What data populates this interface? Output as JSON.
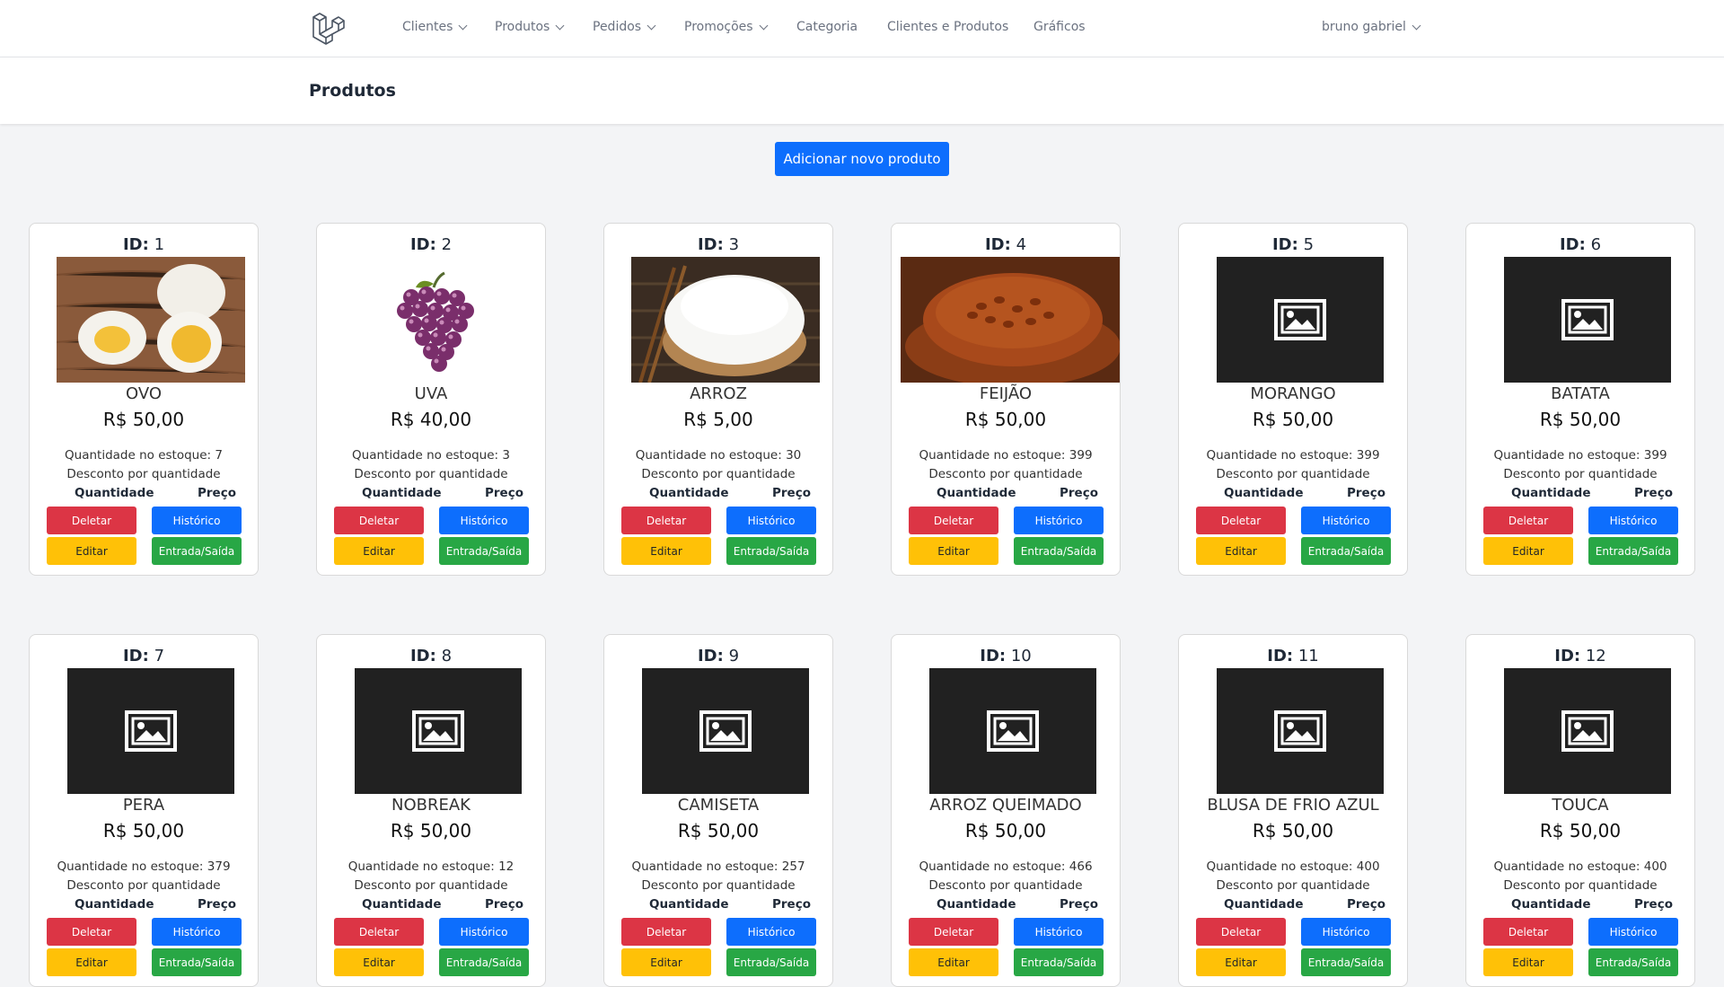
{
  "nav": {
    "items": [
      {
        "label": "Clientes",
        "dropdown": true
      },
      {
        "label": "Produtos",
        "dropdown": true
      },
      {
        "label": "Pedidos",
        "dropdown": true
      },
      {
        "label": "Promoções",
        "dropdown": true
      },
      {
        "label": "Categoria",
        "dropdown": false
      },
      {
        "label": "Clientes e Produtos",
        "dropdown": false
      },
      {
        "label": "Gráficos",
        "dropdown": false
      }
    ],
    "user": "bruno gabriel"
  },
  "page": {
    "title": "Produtos",
    "add_button": "Adicionar novo produto"
  },
  "labels": {
    "id": "ID:",
    "stock_prefix": "Quantidade no estoque:",
    "discount": "Desconto por quantidade",
    "col_qty": "Quantidade",
    "col_price": "Preço",
    "delete": "Deletar",
    "history": "Histórico",
    "edit": "Editar",
    "in_out": "Entrada/Saída"
  },
  "products": [
    {
      "id": "1",
      "name": "OVO",
      "price": "R$ 50,00",
      "stock": "7",
      "image": "eggs-photo"
    },
    {
      "id": "2",
      "name": "UVA",
      "price": "R$ 40,00",
      "stock": "3",
      "image": "grapes-photo"
    },
    {
      "id": "3",
      "name": "ARROZ",
      "price": "R$ 5,00",
      "stock": "30",
      "image": "rice-photo"
    },
    {
      "id": "4",
      "name": "FEIJÃO",
      "price": "R$ 50,00",
      "stock": "399",
      "image": "beans-photo"
    },
    {
      "id": "5",
      "name": "MORANGO",
      "price": "R$ 50,00",
      "stock": "399",
      "image": "placeholder"
    },
    {
      "id": "6",
      "name": "BATATA",
      "price": "R$ 50,00",
      "stock": "399",
      "image": "placeholder"
    },
    {
      "id": "7",
      "name": "PERA",
      "price": "R$ 50,00",
      "stock": "379",
      "image": "placeholder"
    },
    {
      "id": "8",
      "name": "NOBREAK",
      "price": "R$ 50,00",
      "stock": "12",
      "image": "placeholder"
    },
    {
      "id": "9",
      "name": "CAMISETA",
      "price": "R$ 50,00",
      "stock": "257",
      "image": "placeholder"
    },
    {
      "id": "10",
      "name": "ARROZ QUEIMADO",
      "price": "R$ 50,00",
      "stock": "466",
      "image": "placeholder"
    },
    {
      "id": "11",
      "name": "BLUSA DE FRIO AZUL",
      "price": "R$ 50,00",
      "stock": "400",
      "image": "placeholder"
    },
    {
      "id": "12",
      "name": "TOUCA",
      "price": "R$ 50,00",
      "stock": "400",
      "image": "placeholder"
    }
  ]
}
